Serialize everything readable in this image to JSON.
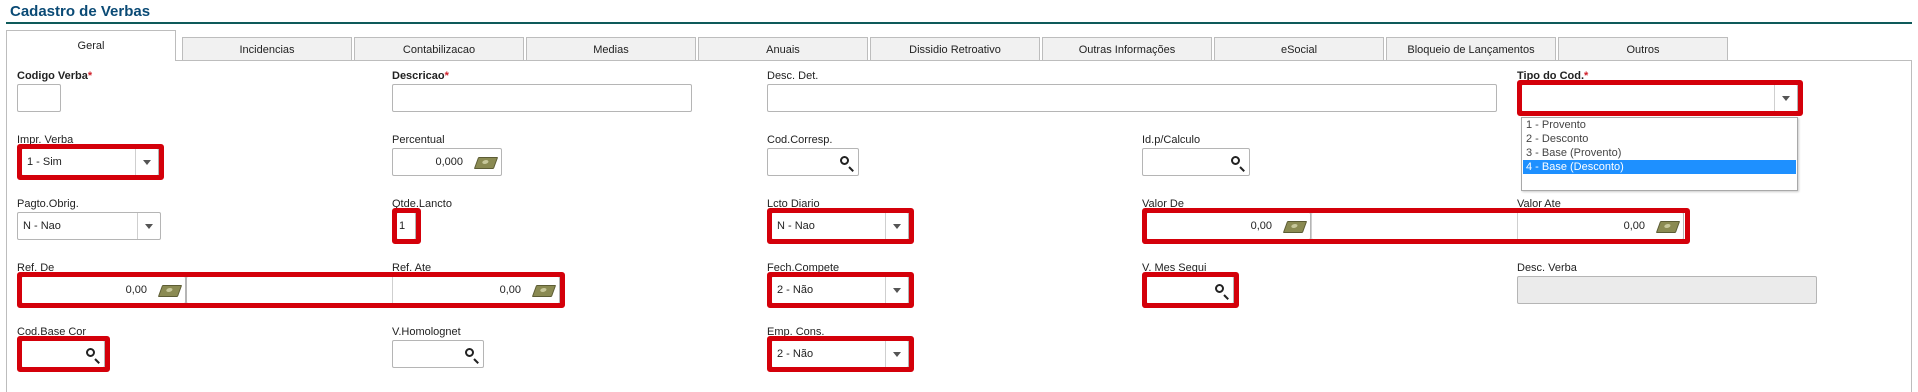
{
  "page": {
    "title": "Cadastro de Verbas"
  },
  "tabs": [
    {
      "label": "Geral",
      "active": true
    },
    {
      "label": "Incidencias"
    },
    {
      "label": "Contabilizacao"
    },
    {
      "label": "Medias"
    },
    {
      "label": "Anuais"
    },
    {
      "label": "Dissidio Retroativo"
    },
    {
      "label": "Outras Informações"
    },
    {
      "label": "eSocial"
    },
    {
      "label": "Bloqueio de Lançamentos"
    },
    {
      "label": "Outros"
    }
  ],
  "form": {
    "codigo_verba": {
      "label": "Codigo Verba",
      "required_mark": "*",
      "value": ""
    },
    "descricao": {
      "label": "Descricao",
      "required_mark": "*",
      "value": ""
    },
    "desc_det": {
      "label": "Desc. Det.",
      "value": ""
    },
    "tipo_cod": {
      "label": "Tipo do Cod.",
      "required_mark": "*",
      "value": "",
      "options": [
        "1 - Provento",
        "2 - Desconto",
        "3 - Base (Provento)",
        "4 - Base (Desconto)"
      ],
      "highlighted_option": "4 - Base (Desconto)"
    },
    "impr_verba": {
      "label": "Impr. Verba",
      "value": "1 - Sim"
    },
    "percentual": {
      "label": "Percentual",
      "value": "0,000"
    },
    "cod_corresp": {
      "label": "Cod.Corresp.",
      "value": ""
    },
    "id_calculo": {
      "label": "Id.p/Calculo",
      "value": ""
    },
    "pagto_obrig": {
      "label": "Pagto.Obrig.",
      "value": "N - Nao"
    },
    "qtde_lancto": {
      "label": "Qtde.Lancto",
      "value": "1"
    },
    "lcto_diario": {
      "label": "Lcto Diario",
      "value": "N - Nao"
    },
    "valor_de": {
      "label": "Valor De",
      "value": "0,00"
    },
    "valor_ate": {
      "label": "Valor Ate",
      "value": "0,00"
    },
    "ref_de": {
      "label": "Ref. De",
      "value": "0,00"
    },
    "ref_ate": {
      "label": "Ref. Ate",
      "value": "0,00"
    },
    "fech_compete": {
      "label": "Fech.Compete",
      "value": "2 - Não"
    },
    "v_mes_segui": {
      "label": "V. Mes Segui",
      "value": ""
    },
    "desc_verba": {
      "label": "Desc. Verba",
      "value": ""
    },
    "cod_base_cor": {
      "label": "Cod.Base Cor",
      "value": ""
    },
    "v_homolognet": {
      "label": "V.Homolognet",
      "value": ""
    },
    "emp_cons": {
      "label": "Emp. Cons.",
      "value": "2 - Não"
    }
  },
  "colors": {
    "title": "#0a4a75",
    "highlight": "#d4000a",
    "selected_option": "#1e90ff",
    "required": "#d0202a"
  },
  "icons": {
    "lookup": "search-icon",
    "currency": "money-icon",
    "select": "chevron-down-icon"
  }
}
